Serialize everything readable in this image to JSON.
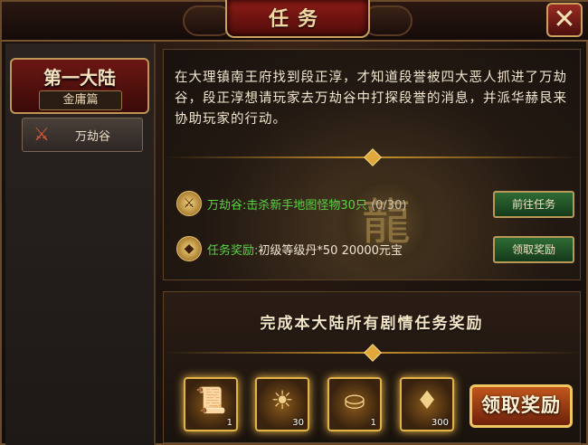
{
  "window": {
    "title": "任务",
    "close_icon": "close-icon"
  },
  "sidebar": {
    "chapter_title": "第一大陆",
    "chapter_subtitle": "金庸篇",
    "items": [
      {
        "label": "万劫谷",
        "icon": "crossed-swords-icon"
      }
    ]
  },
  "quest": {
    "description": "在大理镇南王府找到段正淳，才知道段誉被四大恶人抓进了万劫谷，段正淳想请玩家去万劫谷中打探段誉的消息，并派华赫艮来协助玩家的行动。",
    "objective": {
      "location": "万劫谷:",
      "task": "击杀新手地图怪物30只",
      "progress": "(0/30)",
      "button": "前往任务",
      "icon": "weapon-icon"
    },
    "reward": {
      "label": "任务奖励:",
      "items": "初级等级丹*50  20000元宝",
      "button": "领取奖励",
      "icon": "gold-ingot-icon"
    }
  },
  "chapter_reward": {
    "title": "完成本大陆所有剧情任务奖励",
    "items": [
      {
        "icon": "scroll-icon",
        "count": "1"
      },
      {
        "icon": "fire-orb-icon",
        "count": "30"
      },
      {
        "icon": "gold-ingot-icon",
        "count": "1"
      },
      {
        "icon": "red-gem-icon",
        "count": "300"
      }
    ],
    "claim_button": "领取奖励"
  },
  "colors": {
    "accent_gold": "#e4b348",
    "objective_green": "#5ad443",
    "title_red": "#8e1c17"
  }
}
